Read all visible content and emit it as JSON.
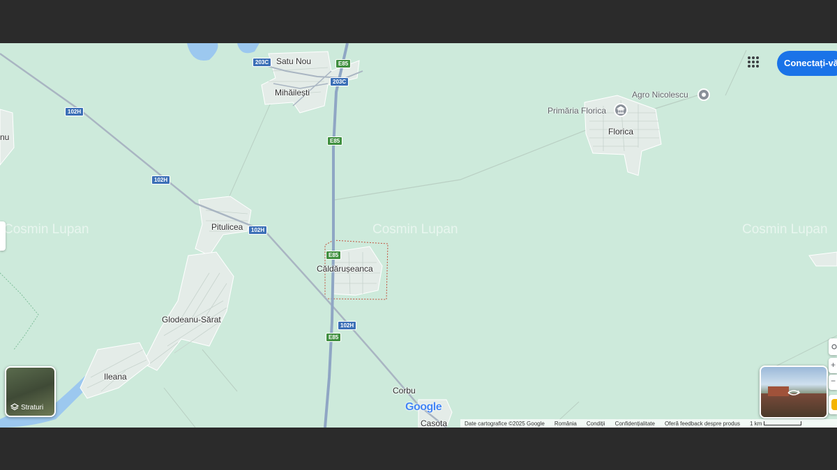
{
  "header": {
    "signin_label": "Conectați-vă"
  },
  "places": {
    "satu_nou": "Satu Nou",
    "mihailesti": "Mihăilești",
    "florica": "Florica",
    "pitulicea": "Pitulicea",
    "caldaruseanca": "Căldărușeanca",
    "glodeanu_sarat": "Glodeanu-Sărat",
    "ileana": "Ileana",
    "corbu": "Corbu",
    "casota": "Casota",
    "edge_left": "nu"
  },
  "pois": {
    "agro_nicolescu": "Agro Nicolescu",
    "primaria_florica": "Primăria Florica"
  },
  "road_shields": {
    "r203c_a": "203C",
    "r203c_b": "203C",
    "e85_a": "E85",
    "e85_b": "E85",
    "e85_c": "E85",
    "e85_d": "E85",
    "r102h_a": "102H",
    "r102h_b": "102H",
    "r102h_c": "102H",
    "r102h_d": "102H"
  },
  "watermark": {
    "text": "Cosmin Lupan"
  },
  "controls": {
    "layers_label": "Straturi"
  },
  "logo": {
    "text": "Google"
  },
  "footer": {
    "map_data": "Date cartografice ©2025 Google",
    "country": "România",
    "terms": "Condiții",
    "privacy": "Confidențialitate",
    "feedback": "Oferă feedback despre produs",
    "scale": "1 km"
  },
  "colors": {
    "map_background": "#cdeadb",
    "highway": "#8fa6c4",
    "road": "#a9b5c2",
    "town_fill": "#e4ece8",
    "water": "#9cc8ef",
    "accent": "#1a73e8",
    "boundary": "#c0503c"
  }
}
